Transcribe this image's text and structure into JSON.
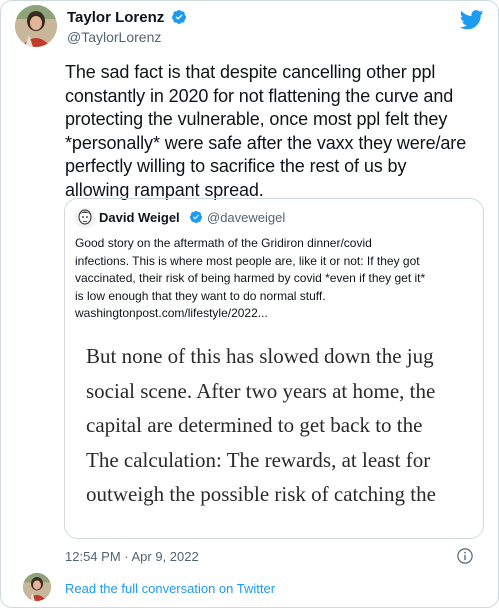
{
  "tweet": {
    "author": {
      "name": "Taylor Lorenz",
      "handle": "@TaylorLorenz"
    },
    "text": "The sad fact is that despite cancelling other ppl\nconstantly in 2020 for not flattening the curve and\nprotecting the vulnerable, once most ppl felt they\n*personally* were safe after the vaxx they were/are\nperfectly willing to sacrifice the rest of us by\nallowing rampant spread.",
    "timestamp": "12:54 PM · Apr 9, 2022"
  },
  "quote": {
    "author": {
      "name": "David Weigel",
      "handle": "@daveweigel"
    },
    "text": "Good story on the aftermath of the Gridiron dinner/covid\ninfections. This is where most people are, like it or not: If they got\nvaccinated, their risk of being harmed by covid *even if they get it*\nis low enough that they want to do normal stuff.\nwashingtonpost.com/lifestyle/2022...",
    "image_text": "But none of this has slowed down the jug\nsocial scene. After two years at home, the\ncapital are determined to get back to the\nThe calculation: The rewards, at least for\noutweigh the possible risk of catching the"
  },
  "footer": {
    "read_link": "Read the full conversation on Twitter"
  },
  "icons": {
    "logo": "twitter-bird-icon",
    "verified": "verified-badge-icon",
    "info": "info-icon"
  },
  "colors": {
    "accent": "#1d9bf0",
    "muted": "#536471",
    "text": "#0f1419",
    "border": "#cfd9de"
  }
}
